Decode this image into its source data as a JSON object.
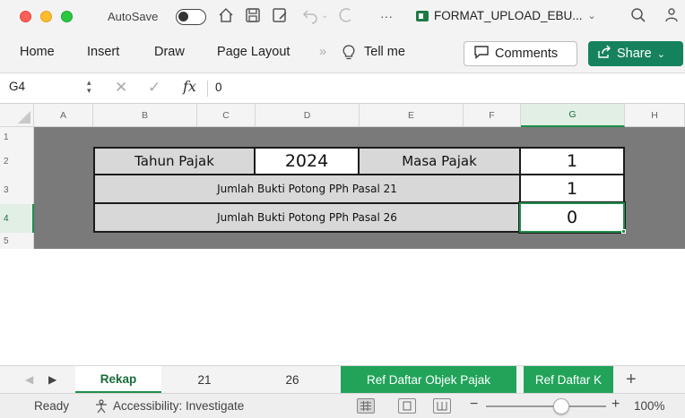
{
  "titlebar": {
    "autosave_label": "AutoSave",
    "file_title": "FORMAT_UPLOAD_EBU...",
    "icons": [
      "home-icon",
      "save-icon",
      "save-as-icon",
      "undo-icon",
      "redo-icon",
      "more-icon",
      "search-icon",
      "people-icon"
    ]
  },
  "ribbon": {
    "tabs": [
      "Home",
      "Insert",
      "Draw",
      "Page Layout"
    ],
    "more": "»",
    "tell_me": "Tell me",
    "comments": "Comments",
    "share": "Share"
  },
  "formula_bar": {
    "name_box": "G4",
    "fx": "fx",
    "value": "0"
  },
  "columns": [
    "A",
    "B",
    "C",
    "D",
    "E",
    "F",
    "G",
    "H"
  ],
  "rows": [
    "1",
    "2",
    "3",
    "4",
    "5"
  ],
  "selected_cell": "G4",
  "sheet": {
    "tahun_label": "Tahun Pajak",
    "tahun_value": "2024",
    "masa_label": "Masa Pajak",
    "masa_value": "1",
    "pasal21_label": "Jumlah Bukti Potong PPh Pasal 21",
    "pasal21_value": "1",
    "pasal26_label": "Jumlah Bukti Potong PPh Pasal 26",
    "pasal26_value": "0"
  },
  "sheet_tabs": {
    "items": [
      "Rekap",
      "21",
      "26",
      "Ref Daftar Objek Pajak",
      "Ref Daftar K"
    ],
    "active": "Rekap",
    "add": "+"
  },
  "statusbar": {
    "ready": "Ready",
    "accessibility": "Accessibility: Investigate",
    "zoom_minus": "−",
    "zoom_plus": "+",
    "zoom": "100%",
    "zoom_percent": 100
  },
  "colors": {
    "accent_green": "#1f8e4c",
    "share_green": "#16825d",
    "tab_green": "#21a35a",
    "band_gray": "#7a7a7a"
  }
}
